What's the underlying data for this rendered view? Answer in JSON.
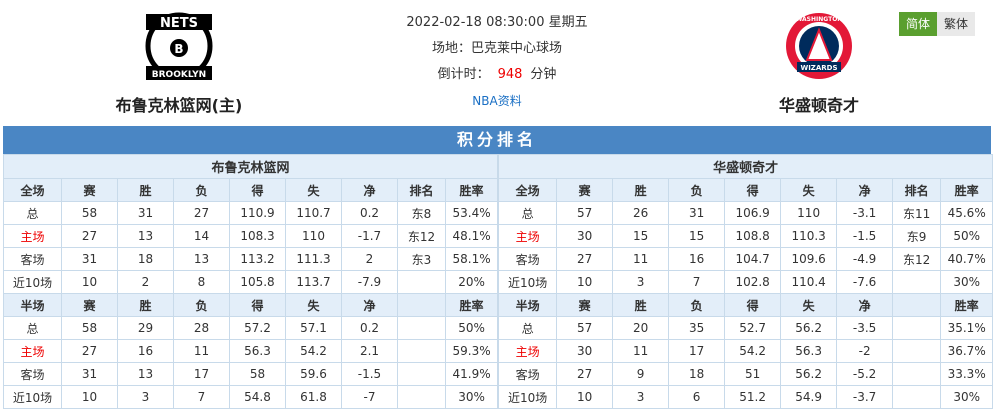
{
  "home": {
    "name": "布鲁克林篮网(主)",
    "logo_text_top": "NETS",
    "logo_text_bottom": "BROOKLYN"
  },
  "away": {
    "name": "华盛顿奇才",
    "logo_text_top": "WASHINGTON",
    "logo_text_bottom": "WIZARDS"
  },
  "match": {
    "datetime": "2022-02-18 08:30:00 星期五",
    "venue": "场地：巴克莱中心球场",
    "countdown_label": "倒计时：",
    "countdown_value": "948",
    "countdown_unit": "分钟",
    "nba_link": "NBA资料"
  },
  "lang": {
    "simplified": "简体",
    "traditional": "繁体"
  },
  "banner": "积分排名",
  "colors": {
    "accent_blue": "#4a86c4",
    "header_bg": "#e3eef9",
    "home_red": "#e00",
    "active_green": "#5a9f2f"
  },
  "left": {
    "team": "布鲁克林篮网",
    "full_header": [
      "全场",
      "赛",
      "胜",
      "负",
      "得",
      "失",
      "净",
      "排名",
      "胜率"
    ],
    "full_rows": [
      [
        "总",
        "58",
        "31",
        "27",
        "110.9",
        "110.7",
        "0.2",
        "东8",
        "53.4%"
      ],
      [
        "主场",
        "27",
        "13",
        "14",
        "108.3",
        "110",
        "-1.7",
        "东12",
        "48.1%"
      ],
      [
        "客场",
        "31",
        "18",
        "13",
        "113.2",
        "111.3",
        "2",
        "东3",
        "58.1%"
      ],
      [
        "近10场",
        "10",
        "2",
        "8",
        "105.8",
        "113.7",
        "-7.9",
        "",
        "20%"
      ]
    ],
    "half_header": [
      "半场",
      "赛",
      "胜",
      "负",
      "得",
      "失",
      "净",
      "",
      "胜率"
    ],
    "half_rows": [
      [
        "总",
        "58",
        "29",
        "28",
        "57.2",
        "57.1",
        "0.2",
        "",
        "50%"
      ],
      [
        "主场",
        "27",
        "16",
        "11",
        "56.3",
        "54.2",
        "2.1",
        "",
        "59.3%"
      ],
      [
        "客场",
        "31",
        "13",
        "17",
        "58",
        "59.6",
        "-1.5",
        "",
        "41.9%"
      ],
      [
        "近10场",
        "10",
        "3",
        "7",
        "54.8",
        "61.8",
        "-7",
        "",
        "30%"
      ]
    ]
  },
  "right": {
    "team": "华盛顿奇才",
    "full_header": [
      "全场",
      "赛",
      "胜",
      "负",
      "得",
      "失",
      "净",
      "排名",
      "胜率"
    ],
    "full_rows": [
      [
        "总",
        "57",
        "26",
        "31",
        "106.9",
        "110",
        "-3.1",
        "东11",
        "45.6%"
      ],
      [
        "主场",
        "30",
        "15",
        "15",
        "108.8",
        "110.3",
        "-1.5",
        "东9",
        "50%"
      ],
      [
        "客场",
        "27",
        "11",
        "16",
        "104.7",
        "109.6",
        "-4.9",
        "东12",
        "40.7%"
      ],
      [
        "近10场",
        "10",
        "3",
        "7",
        "102.8",
        "110.4",
        "-7.6",
        "",
        "30%"
      ]
    ],
    "half_header": [
      "半场",
      "赛",
      "胜",
      "负",
      "得",
      "失",
      "净",
      "",
      "胜率"
    ],
    "half_rows": [
      [
        "总",
        "57",
        "20",
        "35",
        "52.7",
        "56.2",
        "-3.5",
        "",
        "35.1%"
      ],
      [
        "主场",
        "30",
        "11",
        "17",
        "54.2",
        "56.3",
        "-2",
        "",
        "36.7%"
      ],
      [
        "客场",
        "27",
        "9",
        "18",
        "51",
        "56.2",
        "-5.2",
        "",
        "33.3%"
      ],
      [
        "近10场",
        "10",
        "3",
        "6",
        "51.2",
        "54.9",
        "-3.7",
        "",
        "30%"
      ]
    ]
  }
}
